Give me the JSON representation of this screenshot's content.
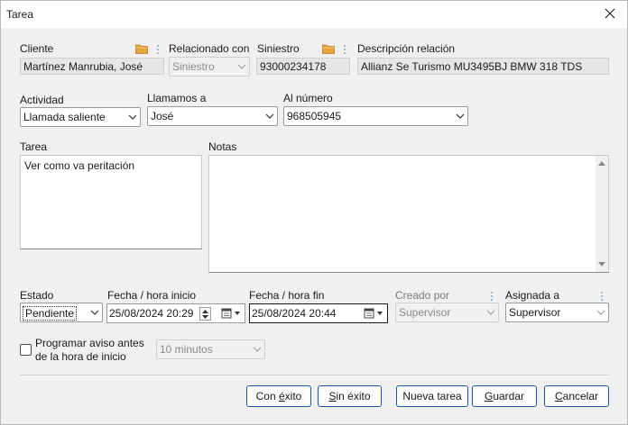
{
  "window": {
    "title": "Tarea"
  },
  "client": {
    "label": "Cliente",
    "value": "Martínez Manrubia, José"
  },
  "related": {
    "label": "Relacionado con",
    "value": "Siniestro"
  },
  "claim": {
    "label": "Siniestro",
    "value": "93000234178"
  },
  "relation": {
    "label": "Descripción relación",
    "value": "Allianz Se Turismo MU3495BJ BMW 318 TDS"
  },
  "activity": {
    "label": "Actividad",
    "value": "Llamada saliente"
  },
  "called": {
    "label": "Llamamos a",
    "value": "José"
  },
  "number": {
    "label": "Al número",
    "value": "968505945"
  },
  "task": {
    "label": "Tarea",
    "value": "Ver como va peritación"
  },
  "notes": {
    "label": "Notas",
    "value": ""
  },
  "status": {
    "label": "Estado",
    "value": "Pendiente"
  },
  "start": {
    "label": "Fecha / hora inicio",
    "value": "25/08/2024 20:29"
  },
  "end": {
    "label": "Fecha / hora fin",
    "value": "25/08/2024 20:44"
  },
  "created": {
    "label": "Creado por",
    "value": "Supervisor"
  },
  "assigned": {
    "label": "Asignada a",
    "value": "Supervisor"
  },
  "reminder": {
    "label_line1": "Programar aviso antes",
    "label_line2": "de la hora de inicio",
    "value": "10 minutos",
    "checked": false
  },
  "buttons": {
    "success_pre": "Con ",
    "success_u": "é",
    "success_post": "xito",
    "fail_pre": "",
    "fail_u": "S",
    "fail_post": "in éxito",
    "new_task": "Nueva tarea",
    "save_pre": "",
    "save_u": "G",
    "save_post": "uardar",
    "cancel_pre": "",
    "cancel_u": "C",
    "cancel_post": "ancelar"
  },
  "colors": {
    "accent": "#1f57a8",
    "folder": "#e8a33d",
    "dots": "#8ea3bd"
  }
}
